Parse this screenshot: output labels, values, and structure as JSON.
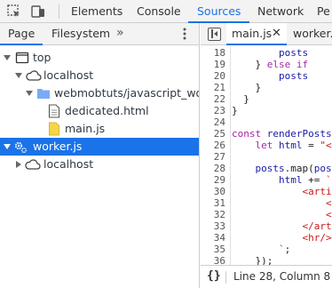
{
  "toolbar": {
    "tabs": [
      {
        "label": "Elements"
      },
      {
        "label": "Console"
      },
      {
        "label": "Sources"
      },
      {
        "label": "Network"
      },
      {
        "label": "Pe"
      }
    ],
    "active_tab": "Sources",
    "icons": [
      "inspect-element-icon",
      "device-toolbar-icon"
    ],
    "accent_color": "#1a73e8"
  },
  "navigator": {
    "tabs": [
      {
        "label": "Page"
      },
      {
        "label": "Filesystem"
      }
    ],
    "more_icon": "double-chevron-icon",
    "menu_icon": "kebab-menu-icon",
    "tree": [
      {
        "label": "top",
        "icon": "frame-icon",
        "expanded": true
      },
      {
        "label": "localhost",
        "icon": "cloud-icon",
        "expanded": true
      },
      {
        "label": "webmobtuts/javascript_workers",
        "icon": "folder-icon",
        "expanded": true
      },
      {
        "label": "dedicated.html",
        "icon": "html-file-icon"
      },
      {
        "label": "main.js",
        "icon": "js-file-icon"
      },
      {
        "label": "worker.js",
        "icon": "worker-gear-icon",
        "expanded": true,
        "selected": true
      },
      {
        "label": "localhost",
        "icon": "cloud-icon",
        "expanded": false
      }
    ]
  },
  "editor": {
    "tabs": [
      {
        "label": "main.js",
        "active": true
      },
      {
        "label": "worker.js"
      }
    ],
    "close_icon": "close-icon",
    "line_numbers": [
      "18",
      "19",
      "20",
      "21",
      "22",
      "23",
      "24",
      "25",
      "26",
      "27",
      "28",
      "29",
      "30",
      "31",
      "32",
      "33",
      "34",
      "35",
      "36"
    ],
    "status": {
      "position": "Line 28, Column 8",
      "format_icon": "pretty-print-icon",
      "format_label": "{}"
    }
  }
}
